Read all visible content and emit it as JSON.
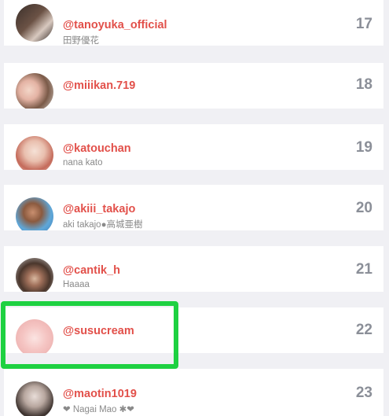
{
  "ranking": {
    "rows": [
      {
        "rank": "17",
        "handle": "@tanoyuka_official",
        "subtitle": "田野優花",
        "avatar": "profile-photo"
      },
      {
        "rank": "18",
        "handle": "@miiikan.719",
        "subtitle": "",
        "avatar": "profile-photo"
      },
      {
        "rank": "19",
        "handle": "@katouchan",
        "subtitle": "nana kato",
        "avatar": "profile-photo"
      },
      {
        "rank": "20",
        "handle": "@akiii_takajo",
        "subtitle": "aki takajo●高城亜樹",
        "avatar": "profile-photo"
      },
      {
        "rank": "21",
        "handle": "@cantik_h",
        "subtitle": "Haaaa",
        "avatar": "monkey-photo"
      },
      {
        "rank": "22",
        "handle": "@susucream",
        "subtitle": "",
        "avatar": "pastel-photo"
      },
      {
        "rank": "23",
        "handle": "@maotin1019",
        "subtitle": "❤ Nagai Mao ✱❤",
        "avatar": "profile-photo"
      }
    ]
  },
  "colors": {
    "highlight": "#1ed141",
    "handle": "#e2504a",
    "rank": "#8b8f98",
    "subtitle": "#8a8a8a"
  }
}
